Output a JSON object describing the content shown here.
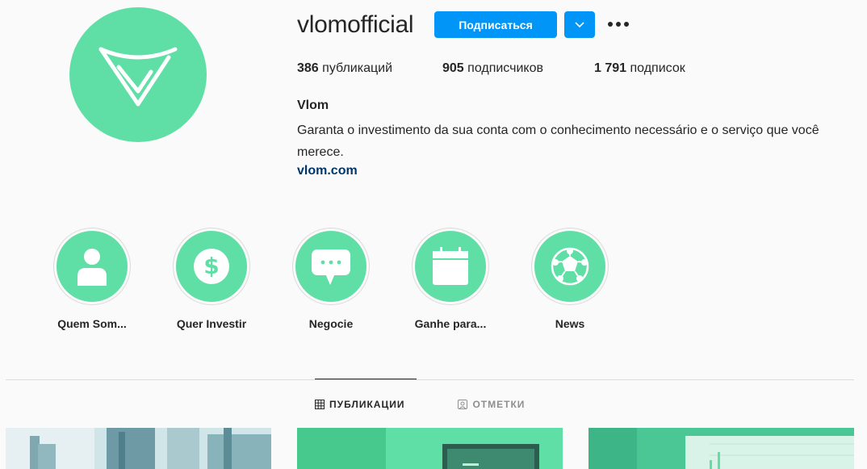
{
  "profile": {
    "username": "vlomofficial",
    "follow_label": "Подписаться",
    "stats": {
      "posts_count": "386",
      "posts_label": " публикаций",
      "followers_count": "905",
      "followers_label": " подписчиков",
      "following_count": "1 791",
      "following_label": " подписок"
    },
    "name": "Vlom",
    "bio": "Garanta o investimento da sua conta com o conhecimento necessário e o serviço que você merece.",
    "link": "vlom.com"
  },
  "highlights": [
    {
      "label": "Quem Som...",
      "icon": "person-icon"
    },
    {
      "label": "Quer Investir",
      "icon": "dollar-icon"
    },
    {
      "label": "Negocie",
      "icon": "chat-bubble-icon"
    },
    {
      "label": "Ganhe para...",
      "icon": "calendar-icon"
    },
    {
      "label": "News",
      "icon": "globe-network-icon"
    }
  ],
  "tabs": {
    "posts_label": "ПУБЛИКАЦИИ",
    "tagged_label": "ОТМЕТКИ"
  },
  "colors": {
    "accent": "#5fdea5",
    "button": "#0095f6",
    "link": "#00376b"
  }
}
